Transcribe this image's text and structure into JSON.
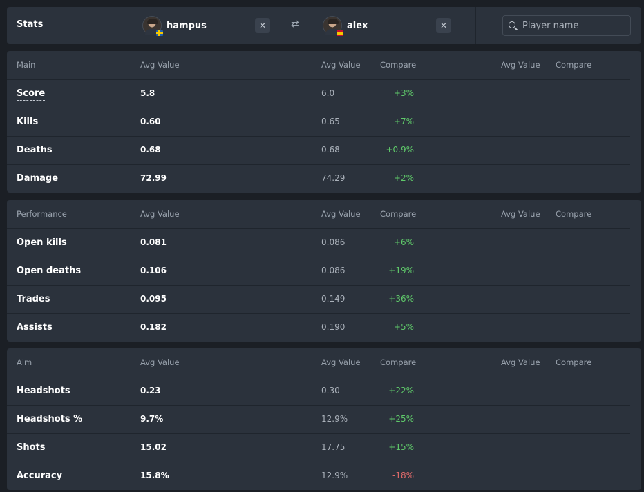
{
  "header": {
    "title": "Stats",
    "swap_icon": "⇄",
    "remove_icon": "✕",
    "player1": {
      "name": "hampus",
      "flag": "SE"
    },
    "player2": {
      "name": "alex",
      "flag": "ES"
    },
    "search": {
      "placeholder": "Player name",
      "value": ""
    }
  },
  "columns": {
    "avg_value": "Avg Value",
    "compare": "Compare"
  },
  "sections": [
    {
      "title": "Main",
      "rows": [
        {
          "label": "Score",
          "v1": "5.8",
          "v2": "6.0",
          "compare": "+3%",
          "trend": "pos"
        },
        {
          "label": "Kills",
          "v1": "0.60",
          "v2": "0.65",
          "compare": "+7%",
          "trend": "pos"
        },
        {
          "label": "Deaths",
          "v1": "0.68",
          "v2": "0.68",
          "compare": "+0.9%",
          "trend": "pos"
        },
        {
          "label": "Damage",
          "v1": "72.99",
          "v2": "74.29",
          "compare": "+2%",
          "trend": "pos"
        }
      ]
    },
    {
      "title": "Performance",
      "rows": [
        {
          "label": "Open kills",
          "v1": "0.081",
          "v2": "0.086",
          "compare": "+6%",
          "trend": "pos"
        },
        {
          "label": "Open deaths",
          "v1": "0.106",
          "v2": "0.086",
          "compare": "+19%",
          "trend": "pos"
        },
        {
          "label": "Trades",
          "v1": "0.095",
          "v2": "0.149",
          "compare": "+36%",
          "trend": "pos"
        },
        {
          "label": "Assists",
          "v1": "0.182",
          "v2": "0.190",
          "compare": "+5%",
          "trend": "pos"
        }
      ]
    },
    {
      "title": "Aim",
      "rows": [
        {
          "label": "Headshots",
          "v1": "0.23",
          "v2": "0.30",
          "compare": "+22%",
          "trend": "pos"
        },
        {
          "label": "Headshots %",
          "v1": "9.7%",
          "v2": "12.9%",
          "compare": "+25%",
          "trend": "pos"
        },
        {
          "label": "Shots",
          "v1": "15.02",
          "v2": "17.75",
          "compare": "+15%",
          "trend": "pos"
        },
        {
          "label": "Accuracy",
          "v1": "15.8%",
          "v2": "12.9%",
          "compare": "-18%",
          "trend": "neg"
        }
      ]
    }
  ],
  "colors": {
    "positive": "#5fc96a",
    "negative": "#e06a6a",
    "panel": "#2b323c",
    "background": "#1b1f25"
  }
}
